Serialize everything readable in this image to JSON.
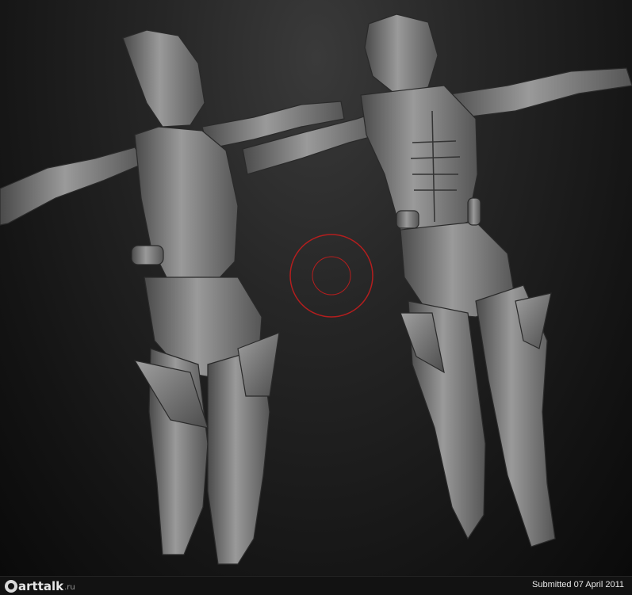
{
  "image": {
    "description_colors": {
      "background": "#262626",
      "model": "#8a8a8a",
      "cursor_ring": "#b41e1e"
    }
  },
  "footer": {
    "logo_text": "arttalk",
    "logo_suffix": ".ru",
    "submitted": "Submitted 07 April 2011"
  }
}
